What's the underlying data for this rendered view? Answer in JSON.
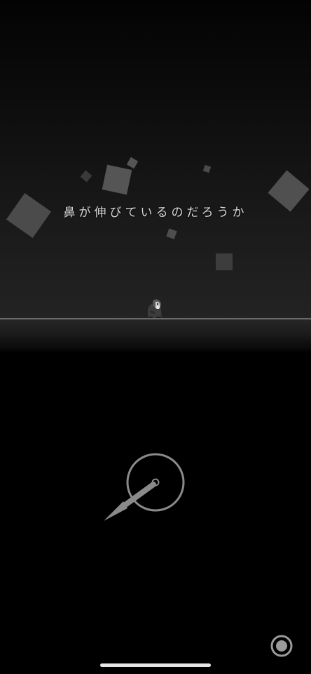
{
  "scene": {
    "narration": "鼻が伸びているのだろうか"
  },
  "icons": {
    "character": "hunched-old-man-sprite",
    "joystick": "joystick-ring-with-arrow-icon",
    "record": "screen-record-icon"
  },
  "colors": {
    "background": "#000000",
    "ground_line": "#6a6a6a",
    "text": "#d8d8d8",
    "joystick": "#8a8a8a"
  }
}
